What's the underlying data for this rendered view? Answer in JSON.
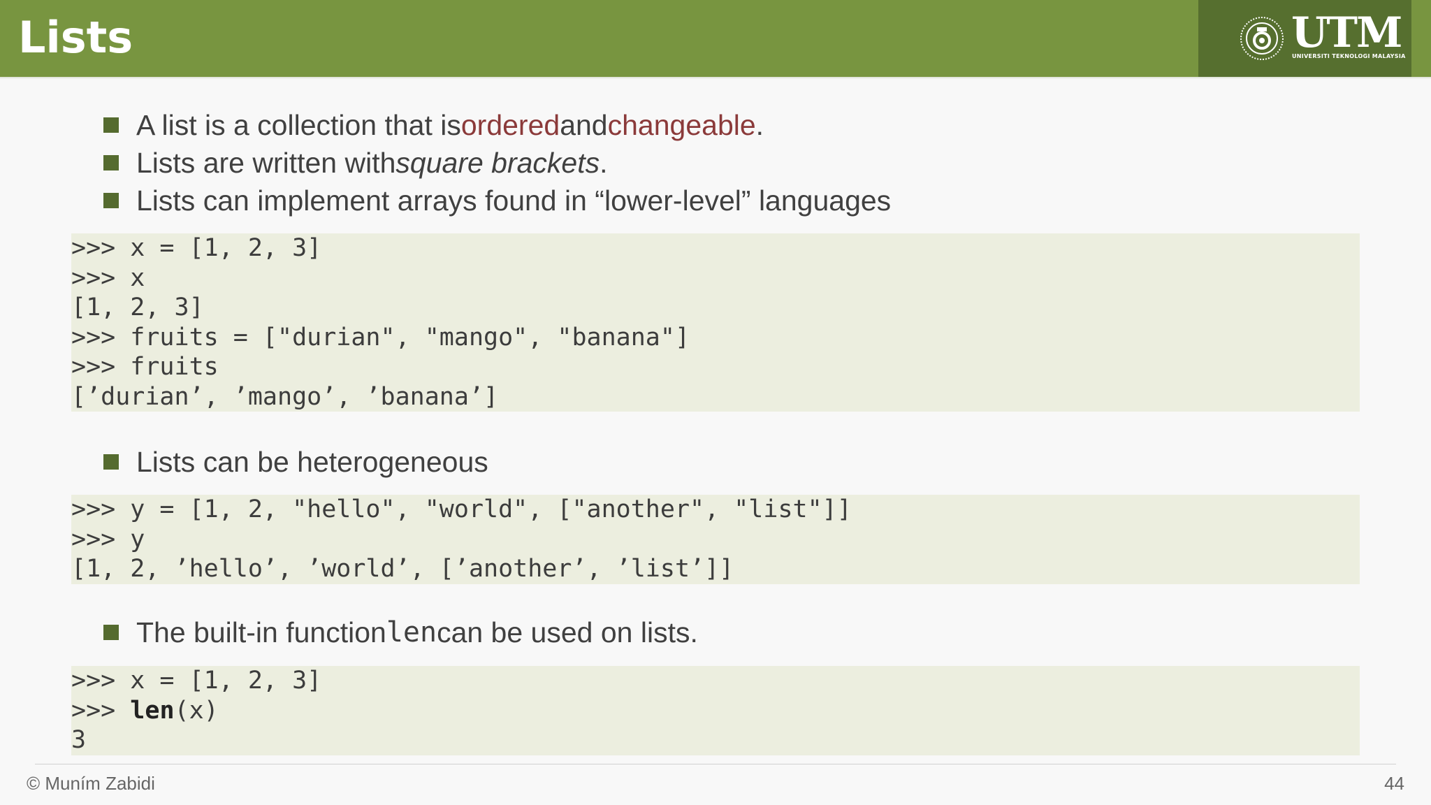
{
  "header": {
    "title": "Lists",
    "logo_text": "UTM",
    "logo_subtitle": "UNIVERSITI TEKNOLOGI MALAYSIA"
  },
  "bullets_top": [
    {
      "pre": "A list is a collection that is ",
      "hl1": "ordered",
      "mid": " and ",
      "hl2": "changeable",
      "post": "."
    },
    {
      "pre": "Lists are written with ",
      "italic": "square brackets",
      "post": "."
    },
    {
      "text": "Lists can implement arrays found in “lower-level” languages"
    }
  ],
  "code1": [
    ">>> x = [1, 2, 3]",
    ">>> x",
    "[1, 2, 3]",
    ">>> fruits = [\"durian\", \"mango\", \"banana\"]",
    ">>> fruits",
    "[’durian’, ’mango’, ’banana’]"
  ],
  "bullet_hetero": "Lists can be heterogeneous",
  "code2": [
    ">>> y = [1, 2, \"hello\", \"world\", [\"another\", \"list\"]]",
    ">>> y",
    "[1, 2, ’hello’, ’world’, [’another’, ’list’]]"
  ],
  "bullet_len": {
    "pre": "The built-in function ",
    "code": "len",
    "post": " can be used on lists."
  },
  "code3": {
    "line1": ">>> x = [1, 2, 3]",
    "line2_prompt": ">>> ",
    "line2_kw": "len",
    "line2_rest": "(x)",
    "line3": "3"
  },
  "footer": {
    "author": "© Muním Zabidi",
    "page": "44"
  },
  "colors": {
    "header_bg": "#789540",
    "logo_bg": "#566f2f",
    "bullet_marker": "#556b2f",
    "highlight": "#8b3a3a",
    "code_bg": "#eceedf"
  }
}
